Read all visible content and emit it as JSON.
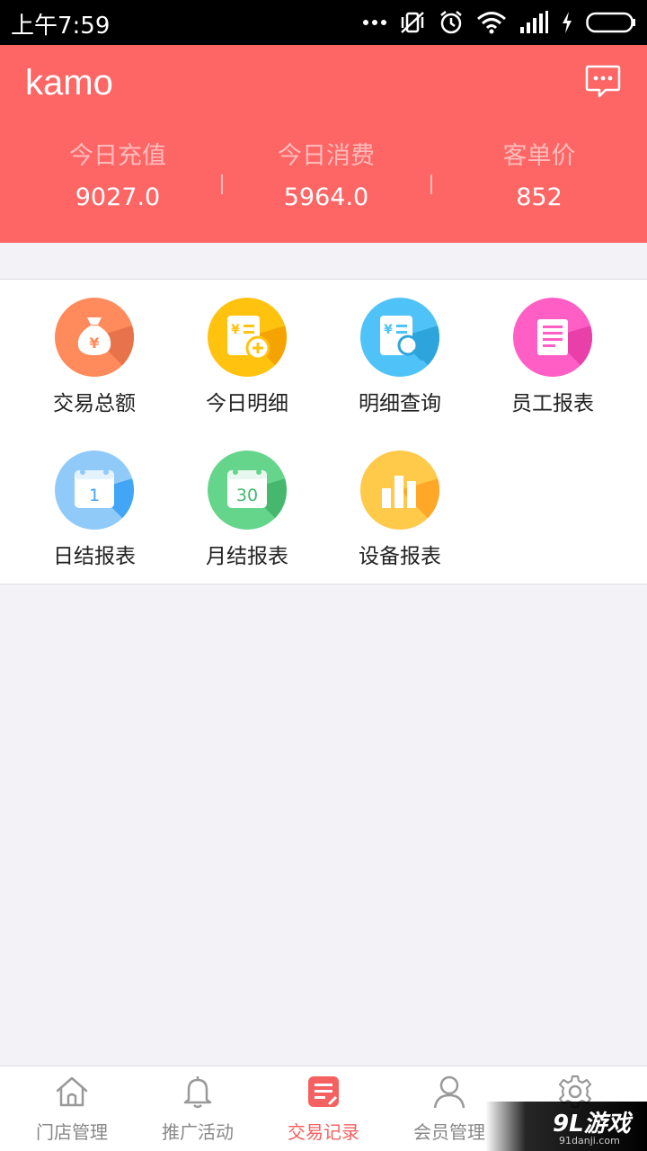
{
  "status_bar": {
    "time": "上午7:59"
  },
  "header": {
    "logo_text": "KAMO",
    "message_icon": "chat-bubble-icon",
    "background_color": "#fe6565",
    "stats": [
      {
        "label": "今日充值",
        "value": "9027.0"
      },
      {
        "label": "今日消费",
        "value": "5964.0"
      },
      {
        "label": "客单价",
        "value": "852"
      }
    ]
  },
  "grid": {
    "items": [
      {
        "label": "交易总额",
        "icon": "money-bag-icon",
        "color": "#ff8a5b"
      },
      {
        "label": "今日明细",
        "icon": "receipt-plus-icon",
        "color": "#ffc20e"
      },
      {
        "label": "明细查询",
        "icon": "receipt-search-icon",
        "color": "#4fc3f7"
      },
      {
        "label": "员工报表",
        "icon": "document-icon",
        "color": "#ff5ec4"
      },
      {
        "label": "日结报表",
        "icon": "calendar-day-icon",
        "color": "#64b5f6",
        "badge": "1"
      },
      {
        "label": "月结报表",
        "icon": "calendar-month-icon",
        "color": "#66d58c",
        "badge": "30"
      },
      {
        "label": "设备报表",
        "icon": "bar-chart-icon",
        "color": "#ffc94a"
      }
    ]
  },
  "tab_bar": {
    "active_color": "#f56060",
    "tabs": [
      {
        "label": "门店管理",
        "icon": "home-icon"
      },
      {
        "label": "推广活动",
        "icon": "bell-icon"
      },
      {
        "label": "交易记录",
        "icon": "record-icon",
        "active": true
      },
      {
        "label": "会员管理",
        "icon": "user-icon"
      },
      {
        "label": "",
        "icon": "gear-icon"
      }
    ]
  },
  "watermark": {
    "text": "9L游戏",
    "sub": "91danji.com"
  }
}
